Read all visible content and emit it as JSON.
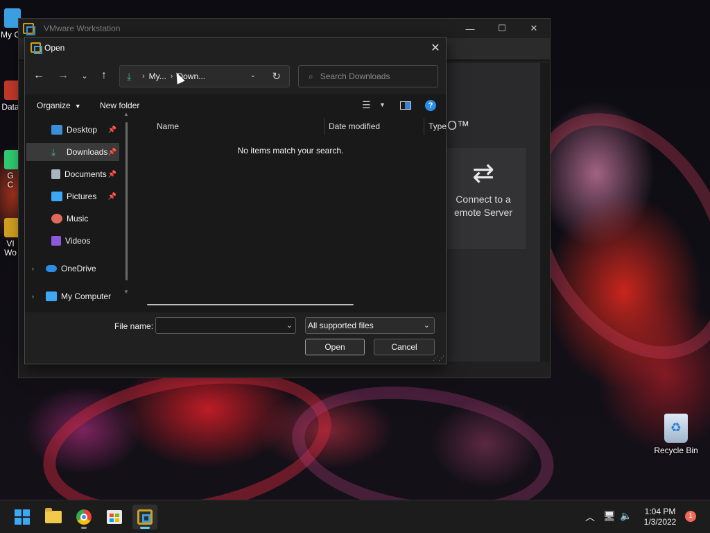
{
  "desktop": {
    "left_icons": [
      {
        "label": "My C",
        "color": "#3b9ee0"
      },
      {
        "label": "Data",
        "color": "#c0392b"
      },
      {
        "label": "G\nC",
        "color": "#2ecc71"
      },
      {
        "label": "VI\nWo",
        "color": "#d0a020"
      }
    ],
    "recycle_bin_label": "Recycle Bin"
  },
  "vmware": {
    "title": "VMware Workstation",
    "controls": [
      "—",
      "☐",
      "✕"
    ],
    "brand_suffix": "O™",
    "remote_card": {
      "line1": "Connect to a",
      "line2": "emote Server",
      "icon": "arrows-swap-icon"
    }
  },
  "dialog": {
    "title": "Open",
    "close_label": "✕",
    "address": {
      "segment1": "My...",
      "segment2": "Down..."
    },
    "search_placeholder": "Search Downloads",
    "toolbar": {
      "organize": "Organize",
      "new_folder": "New folder",
      "help": "?"
    },
    "nav": [
      {
        "label": "Desktop",
        "icon_color": "#3b8fd8",
        "pinned": true
      },
      {
        "label": "Downloads",
        "icon_color": "#3fbf7a",
        "pinned": true,
        "selected": true
      },
      {
        "label": "Documents",
        "icon_color": "#aab4c0",
        "pinned": true
      },
      {
        "label": "Pictures",
        "icon_color": "#3ba7f5",
        "pinned": true
      },
      {
        "label": "Music",
        "icon_color": "#e06a5a"
      },
      {
        "label": "Videos",
        "icon_color": "#8c5ad8"
      },
      {
        "label": "OneDrive",
        "icon_color": "#2a8ee6",
        "expandable": true
      },
      {
        "label": "My Computer",
        "icon_color": "#3ba7f5",
        "expandable": true
      }
    ],
    "columns": [
      "Name",
      "Date modified",
      "Type"
    ],
    "empty_message": "No items match your search.",
    "file_name_label": "File name:",
    "file_name_value": "",
    "file_type": "All supported files",
    "open_button": "Open",
    "cancel_button": "Cancel"
  },
  "taskbar": {
    "time": "1:04 PM",
    "date": "1/3/2022",
    "notifications": "1"
  }
}
